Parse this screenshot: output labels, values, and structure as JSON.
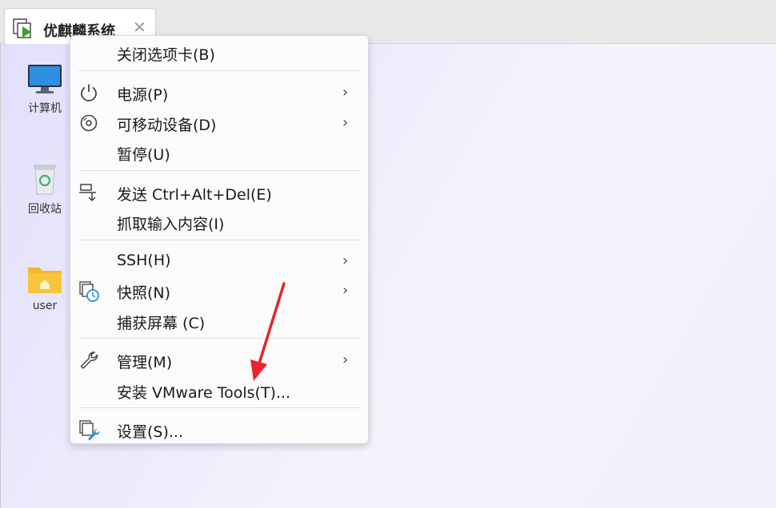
{
  "tab": {
    "title": "优麒麟系统",
    "close_glyph": "✕",
    "icon": "vm-play-icon"
  },
  "desktop": {
    "icons": [
      {
        "label": "计算机",
        "icon": "computer-monitor-icon"
      },
      {
        "label": "回收站",
        "icon": "recycle-bin-icon"
      },
      {
        "label": "user",
        "icon": "home-folder-icon"
      }
    ]
  },
  "menu": {
    "items": [
      {
        "label": "关闭选项卡(B)",
        "icon": "",
        "submenu": false
      },
      {
        "label": "电源(P)",
        "icon": "power-icon",
        "submenu": true
      },
      {
        "label": "可移动设备(D)",
        "icon": "disc-icon",
        "submenu": true
      },
      {
        "label": "暂停(U)",
        "icon": "",
        "submenu": false
      },
      {
        "label": "发送 Ctrl+Alt+Del(E)",
        "icon": "send-keys-icon",
        "submenu": false
      },
      {
        "label": "抓取输入内容(I)",
        "icon": "",
        "submenu": false
      },
      {
        "label": "SSH(H)",
        "icon": "",
        "submenu": true
      },
      {
        "label": "快照(N)",
        "icon": "snapshot-clock-icon",
        "submenu": true
      },
      {
        "label": "捕获屏幕 (C)",
        "icon": "",
        "submenu": false
      },
      {
        "label": "管理(M)",
        "icon": "wrench-icon",
        "submenu": true
      },
      {
        "label": "安装 VMware Tools(T)...",
        "icon": "",
        "submenu": false
      },
      {
        "label": "设置(S)...",
        "icon": "settings-vm-icon",
        "submenu": false
      }
    ],
    "submenu_glyph": "›"
  },
  "annotation": {
    "color": "#e8232a",
    "icon": "red-pointer-arrow-icon"
  }
}
